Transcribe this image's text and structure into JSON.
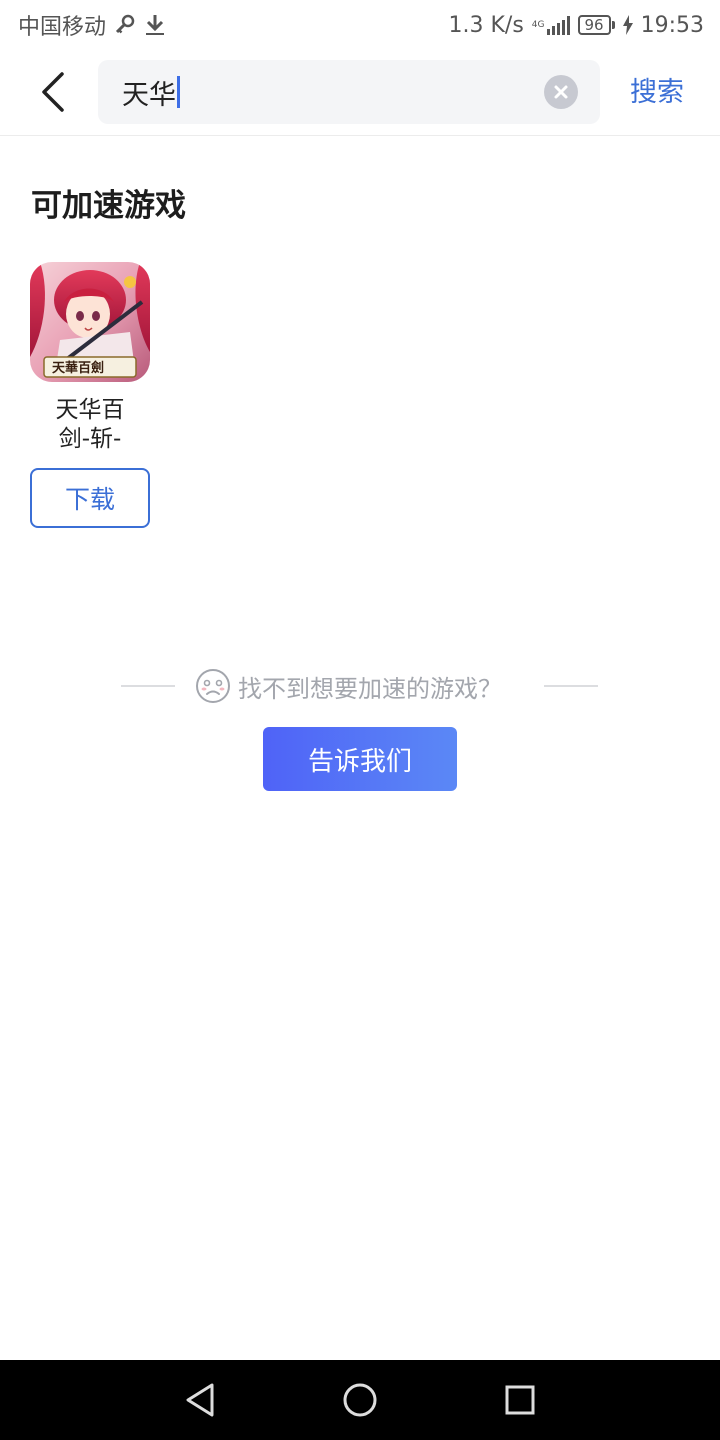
{
  "status_bar": {
    "carrier": "中国移动",
    "net_speed": "1.3 K/s",
    "net_type": "4G",
    "battery": "96",
    "time": "19:53",
    "icons": [
      "key-icon",
      "download-icon",
      "signal-icon",
      "charging-icon"
    ]
  },
  "header": {
    "search_value": "天华",
    "search_button": "搜索",
    "icons": [
      "back-arrow-icon",
      "clear-icon"
    ]
  },
  "section": {
    "title": "可加速游戏",
    "games": [
      {
        "name_line1": "天华百",
        "name_line2": "剑-斩-",
        "icon_text": "天華百劍",
        "button": "下载"
      }
    ]
  },
  "not_found": {
    "text": "找不到想要加速的游戏？",
    "button": "告诉我们",
    "icon": "sad-face-icon"
  },
  "nav_bar": {
    "icons": [
      "back-triangle-icon",
      "home-circle-icon",
      "recents-square-icon"
    ]
  },
  "colors": {
    "accent": "#3b6fd6",
    "button_gradient_start": "#4f63f7",
    "button_gradient_end": "#5b88f6",
    "muted_text": "#a3a6ad"
  }
}
